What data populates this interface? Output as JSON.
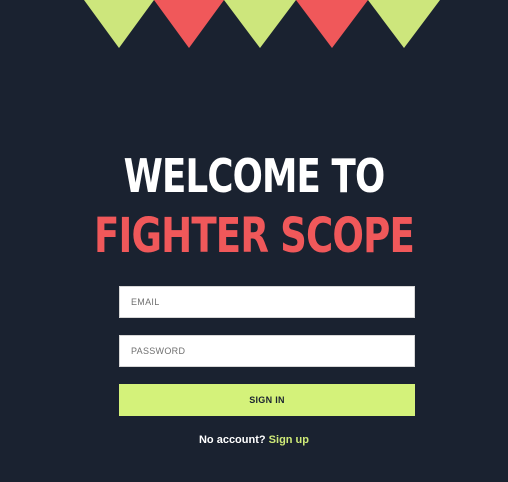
{
  "decoration": {
    "pennant_colors": [
      "#cde67c",
      "#f0585a",
      "#cde67c",
      "#f0585a",
      "#cde67c"
    ]
  },
  "headline": {
    "line1": "WELCOME TO",
    "line2": "FIGHTER SCOPE"
  },
  "form": {
    "email_placeholder": "EMAIL",
    "password_placeholder": "PASSWORD",
    "sign_in_label": "SIGN IN"
  },
  "signup": {
    "prompt": "No account?",
    "link_label": "Sign up"
  },
  "colors": {
    "background": "#1a2230",
    "accent_red": "#f0585a",
    "accent_green": "#d4f27a"
  }
}
